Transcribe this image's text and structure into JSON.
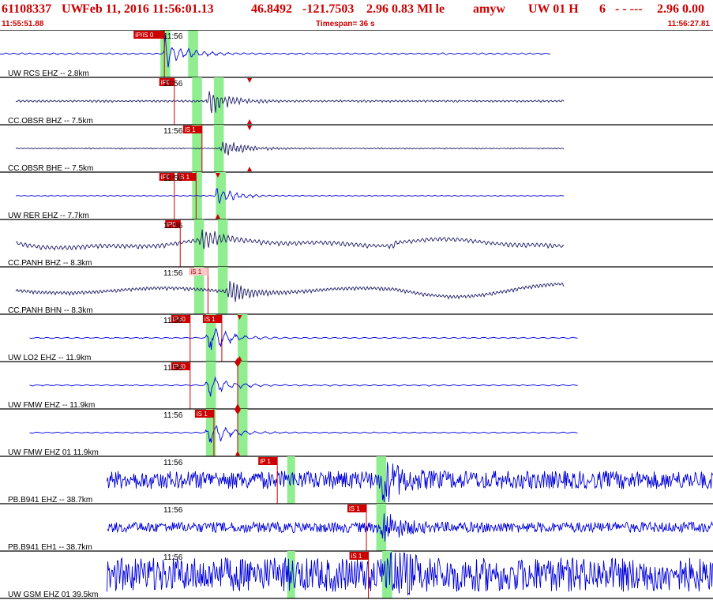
{
  "header": {
    "event_id": "61108337",
    "network": "UW",
    "datetime": "Feb 11, 2016 11:56:01.13",
    "lat": "46.8492",
    "lon": "-121.7503",
    "mag_info": "2.96 0.83 Ml le",
    "author": "amyw",
    "source": "UW 01 H",
    "count": "6",
    "dashes": "- - ---",
    "mag_right": "2.96 0.00",
    "start_time": "11:55:51.88",
    "timespan": "Timespan=  36 s",
    "end_time": "11:56:27.81"
  },
  "colors": {
    "header": "#cc0000",
    "trace_blue": "#0000dd",
    "trace_navy": "#1a1a66",
    "pick_bg": "#cc0000",
    "pick_text": "#ffffff",
    "shade": "#90ee90",
    "divider": "#000000"
  },
  "chart_data": {
    "type": "line",
    "title": "61108337 UW Feb 11, 2016 11:56:01.13",
    "x_range_s": [
      0,
      36
    ],
    "x_start": "11:55:51.88",
    "x_end": "11:56:27.81",
    "tick_label": "11:56",
    "series": [
      {
        "name": "UW RCS EHZ -- 2.8km",
        "color": "#0000dd",
        "start": 0.0,
        "end": 27.8,
        "amp": 0.04,
        "burst": 0.92,
        "onset": 8.3,
        "shape": "quake",
        "period": 0.25,
        "picks": [
          {
            "label": "iP/iS 0",
            "time": 8.3
          }
        ],
        "shades": [
          [
            8.1,
            8.6
          ],
          [
            9.5,
            10.0
          ]
        ]
      },
      {
        "name": "CC.OBSR BHZ -- 7.5km",
        "color": "#1a1a66",
        "start": 0.8,
        "end": 28.5,
        "amp": 0.05,
        "burst": 0.75,
        "onset": 10.5,
        "shape": "quake",
        "period": 0.5,
        "picks": [
          {
            "label": "iP0",
            "time": 8.8
          },
          {
            "label": "",
            "time": 12.6,
            "marker": "tri"
          }
        ],
        "shades": [
          [
            9.7,
            10.2
          ],
          [
            10.8,
            11.3
          ]
        ]
      },
      {
        "name": "CC.OBSR BHE -- 7.5km",
        "color": "#1a1a66",
        "start": 0.8,
        "end": 28.5,
        "amp": 0.03,
        "burst": 0.6,
        "onset": 11.2,
        "shape": "quake",
        "period": 0.55,
        "picks": [
          {
            "label": "iS 1",
            "time": 10.2
          },
          {
            "label": "",
            "time": 12.6,
            "marker": "tri"
          }
        ],
        "shades": [
          [
            9.7,
            10.2
          ],
          [
            10.8,
            11.3
          ]
        ]
      },
      {
        "name": "UW RER EHZ -- 7.7km",
        "color": "#0000dd",
        "start": 0.8,
        "end": 28.5,
        "amp": 0.02,
        "burst": 0.5,
        "onset": 10.9,
        "shape": "quake",
        "period": 0.3,
        "picks": [
          {
            "label": "iP0",
            "time": 8.8
          },
          {
            "label": "iS 1",
            "time": 9.9
          },
          {
            "label": "",
            "time": 11.0,
            "marker": "tri"
          }
        ],
        "shades": [
          [
            9.7,
            10.2
          ],
          [
            10.9,
            11.4
          ]
        ]
      },
      {
        "name": "CC.PANH BHZ -- 8.3km",
        "color": "#1a1a66",
        "start": 0.8,
        "end": 28.5,
        "amp": 0.1,
        "burst": 0.55,
        "onset": 10.2,
        "shape": "swell",
        "period": 0.45,
        "picks": [
          {
            "label": "iP0",
            "time": 9.1
          }
        ],
        "shades": [
          [
            9.8,
            10.3
          ],
          [
            11.0,
            11.5
          ]
        ]
      },
      {
        "name": "CC.PANH BHN -- 8.3km",
        "color": "#1a1a66",
        "start": 0.8,
        "end": 28.5,
        "amp": 0.08,
        "burst": 0.55,
        "onset": 11.5,
        "shape": "swell2",
        "period": 0.55,
        "picks": [
          {
            "label": "iS 1",
            "time": 10.5,
            "ghost": true
          }
        ],
        "shades": [
          [
            9.8,
            10.3
          ],
          [
            11.0,
            11.5
          ]
        ]
      },
      {
        "name": "UW LO2 EHZ -- 11.9km",
        "color": "#0000dd",
        "start": 1.5,
        "end": 29.2,
        "amp": 0.03,
        "burst": 0.8,
        "onset": 10.5,
        "shape": "quake",
        "period": 0.2,
        "picks": [
          {
            "label": "iPd0",
            "time": 9.6
          },
          {
            "label": "iS 1",
            "time": 11.2
          },
          {
            "label": "",
            "time": 12.1,
            "marker": "tri"
          }
        ],
        "shades": [
          [
            10.4,
            10.9
          ],
          [
            12.0,
            12.5
          ]
        ]
      },
      {
        "name": "UW FMW EHZ -- 11.9km",
        "color": "#0000dd",
        "start": 1.5,
        "end": 29.2,
        "amp": 0.03,
        "burst": 0.65,
        "onset": 10.5,
        "shape": "quake",
        "period": 0.2,
        "picks": [
          {
            "label": "iPd0",
            "time": 9.6
          },
          {
            "label": "",
            "time": 12.0,
            "marker": "dia"
          }
        ],
        "shades": [
          [
            10.4,
            10.9
          ],
          [
            12.0,
            12.5
          ]
        ]
      },
      {
        "name": "UW FMW EHZ 01 11.9km",
        "color": "#0000dd",
        "start": 1.5,
        "end": 29.2,
        "amp": 0.03,
        "burst": 0.65,
        "onset": 10.5,
        "shape": "quake",
        "period": 0.2,
        "picks": [
          {
            "label": "iS 1",
            "time": 10.8
          },
          {
            "label": "",
            "time": 12.0,
            "marker": "dia"
          }
        ],
        "shades": [
          [
            10.4,
            10.9
          ],
          [
            12.0,
            12.5
          ]
        ]
      },
      {
        "name": "PB.B941 EHZ -- 38.7km",
        "color": "#0000dd",
        "start": 5.4,
        "end": 36.0,
        "amp": 0.38,
        "burst": 0.9,
        "onset": 19.3,
        "shape": "noise",
        "period": 0.1,
        "picks": [
          {
            "label": "iP 1",
            "time": 14.0
          }
        ],
        "shades": [
          [
            14.5,
            14.9
          ],
          [
            19.0,
            19.5
          ]
        ]
      },
      {
        "name": "PB.B941 EH1 -- 38.7km",
        "color": "#0000dd",
        "start": 5.4,
        "end": 36.0,
        "amp": 0.22,
        "burst": 0.7,
        "onset": 19.3,
        "shape": "noise",
        "period": 0.1,
        "picks": [
          {
            "label": "iS 1",
            "time": 18.5
          }
        ],
        "shades": [
          [
            19.0,
            19.5
          ]
        ]
      },
      {
        "name": "UW GSM EHZ 01 39.5km",
        "color": "#0000dd",
        "start": 5.4,
        "end": 36.0,
        "amp": 0.72,
        "burst": 1.1,
        "onset": 19.5,
        "shape": "noise",
        "period": 0.08,
        "picks": [
          {
            "label": "iS 1",
            "time": 18.6
          }
        ],
        "shades": [
          [
            14.5,
            14.9
          ],
          [
            19.3,
            19.8
          ]
        ]
      }
    ]
  }
}
